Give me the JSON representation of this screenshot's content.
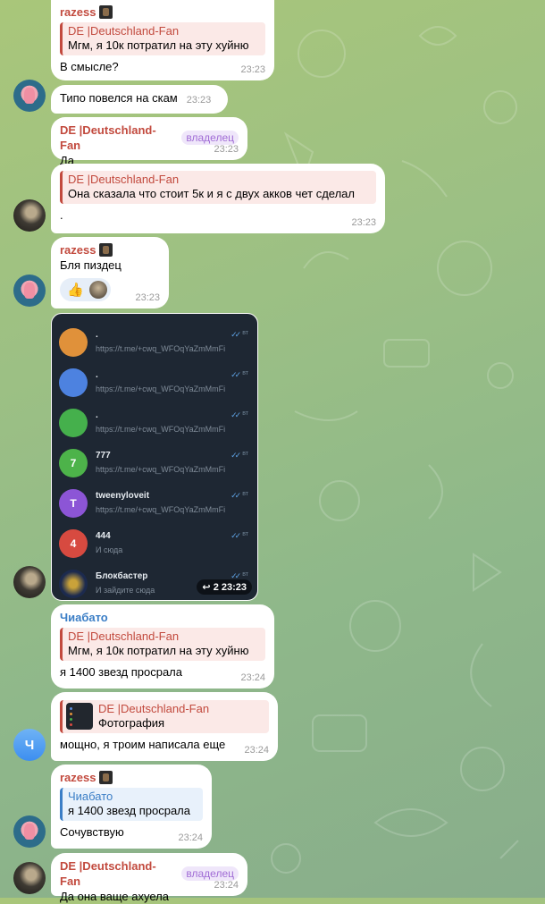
{
  "messages": {
    "m1": {
      "sender": "razess",
      "reply_name": "DE |Deutschland-Fan",
      "reply_text": "Мгм, я 10к потратил на эту хуйню",
      "text": "В смысле?",
      "time": "23:23"
    },
    "m2": {
      "text": "Типо повелся на скам",
      "time": "23:23"
    },
    "m3": {
      "sender": "DE |Deutschland-Fan",
      "badge": "владелец",
      "text": "Да",
      "time": "23:23"
    },
    "m4": {
      "reply_name": "DE |Deutschland-Fan",
      "reply_text": "Она сказала что стоит 5к и я с двух акков чет сделал",
      "text": ".",
      "time": "23:23"
    },
    "m5": {
      "sender": "razess",
      "text": "Бля пиздец",
      "reaction": "👍",
      "time": "23:23"
    },
    "m7": {
      "sender": "Чиабато",
      "reply_name": "DE |Deutschland-Fan",
      "reply_text": "Мгм, я 10к потратил на эту хуйню",
      "text": "я 1400 звезд просрала",
      "time": "23:24"
    },
    "m8": {
      "reply_name": "DE |Deutschland-Fan",
      "reply_text": "Фотография",
      "text": "мощно, я троим написала еще",
      "time": "23:24"
    },
    "m9": {
      "sender": "razess",
      "reply_name": "Чиабато",
      "reply_text": "я 1400 звезд просрала",
      "text": "Сочувствую",
      "time": "23:24"
    },
    "m10": {
      "sender": "DE |Deutschland-Fan",
      "badge": "владелец",
      "text": "Да она ваще ахуела",
      "time": "23:24"
    }
  },
  "avatar_ch_letter": "Ч",
  "screenshot": {
    "forward_label": "2 23:23",
    "chats": [
      {
        "avatar": "",
        "color": "#e0913a",
        "title": ".",
        "sub": "https://t.me/+cwq_WFOqYaZmMmFi",
        "time": "вт"
      },
      {
        "avatar": "",
        "color": "#4d82e0",
        "title": ".",
        "sub": "https://t.me/+cwq_WFOqYaZmMmFi",
        "time": "вт"
      },
      {
        "avatar": "",
        "color": "#45b04c",
        "title": ".",
        "sub": "https://t.me/+cwq_WFOqYaZmMmFi",
        "time": "вт"
      },
      {
        "avatar": "7",
        "color": "#4db34a",
        "title": "777",
        "sub": "https://t.me/+cwq_WFOqYaZmMmFi",
        "time": "вт"
      },
      {
        "avatar": "T",
        "color": "#8c55d6",
        "title": "tweenyloveit",
        "sub": "https://t.me/+cwq_WFOqYaZmMmFi",
        "time": "вт"
      },
      {
        "avatar": "4",
        "color": "#d74a40",
        "title": "444",
        "sub": "И сюда",
        "time": "вт"
      },
      {
        "avatar": "",
        "color": "#1c2a4e",
        "title": "Блокбастер",
        "sub": "И зайдите сюда",
        "time": "вт"
      }
    ]
  }
}
